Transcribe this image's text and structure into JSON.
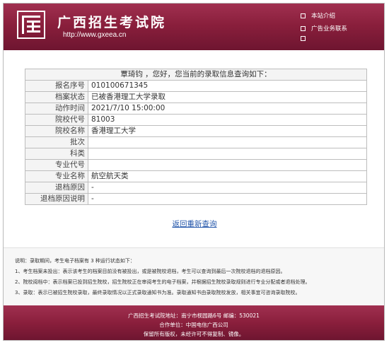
{
  "header": {
    "logo_char": "广",
    "site_title": "广西招生考试院",
    "site_url": "http://www.gxeea.cn",
    "nav": [
      "本站介绍",
      "广告业务联系"
    ]
  },
  "result": {
    "greeting": "覃琦钧 ，您好，您当前的录取信息查询如下：",
    "rows": [
      {
        "label": "报名序号",
        "value": "010100671345"
      },
      {
        "label": "档案状态",
        "value": "已被香港理工大学录取"
      },
      {
        "label": "动作时间",
        "value": "2021/7/10 15:00:00"
      },
      {
        "label": "院校代号",
        "value": "81003"
      },
      {
        "label": "院校名称",
        "value": "香港理工大学"
      },
      {
        "label": "批次",
        "value": ""
      },
      {
        "label": "科类",
        "value": ""
      },
      {
        "label": "专业代号",
        "value": ""
      },
      {
        "label": "专业名称",
        "value": "航空航天类"
      },
      {
        "label": "退档原因",
        "value": "-"
      },
      {
        "label": "退档原因说明",
        "value": "-"
      }
    ],
    "retry_link": "返回重新查询"
  },
  "notes": [
    "说明：录取期间，考生电子档案有 3 种运行状态如下：",
    "1、考生档案未投出：表示该考生的档案目前没有被投出，或是被院校退档，考生可以查询到最后一次院校退档的退档原因。",
    "2、院校阅档中：表示档案已投到招生院校，招生院校正在审阅考生的电子档案，并根据招生院校录取规则进行专业分配或者退档处理。",
    "3、录取：表示已被招生院校录取，最终录取情况以正式录取通知书为准。录取通知书由录取院校发放，相关事宜可咨询录取院校。"
  ],
  "footer": {
    "line1": "广西招生考试院地址：南宁市枧园路6号   邮编：530021",
    "line2": "合作单位：中国电信广西公司",
    "line3": "保留所有版权，未经许可不得复制、镜像。"
  },
  "colors": {
    "brand": "#8a1f3c",
    "link": "#2255aa"
  }
}
